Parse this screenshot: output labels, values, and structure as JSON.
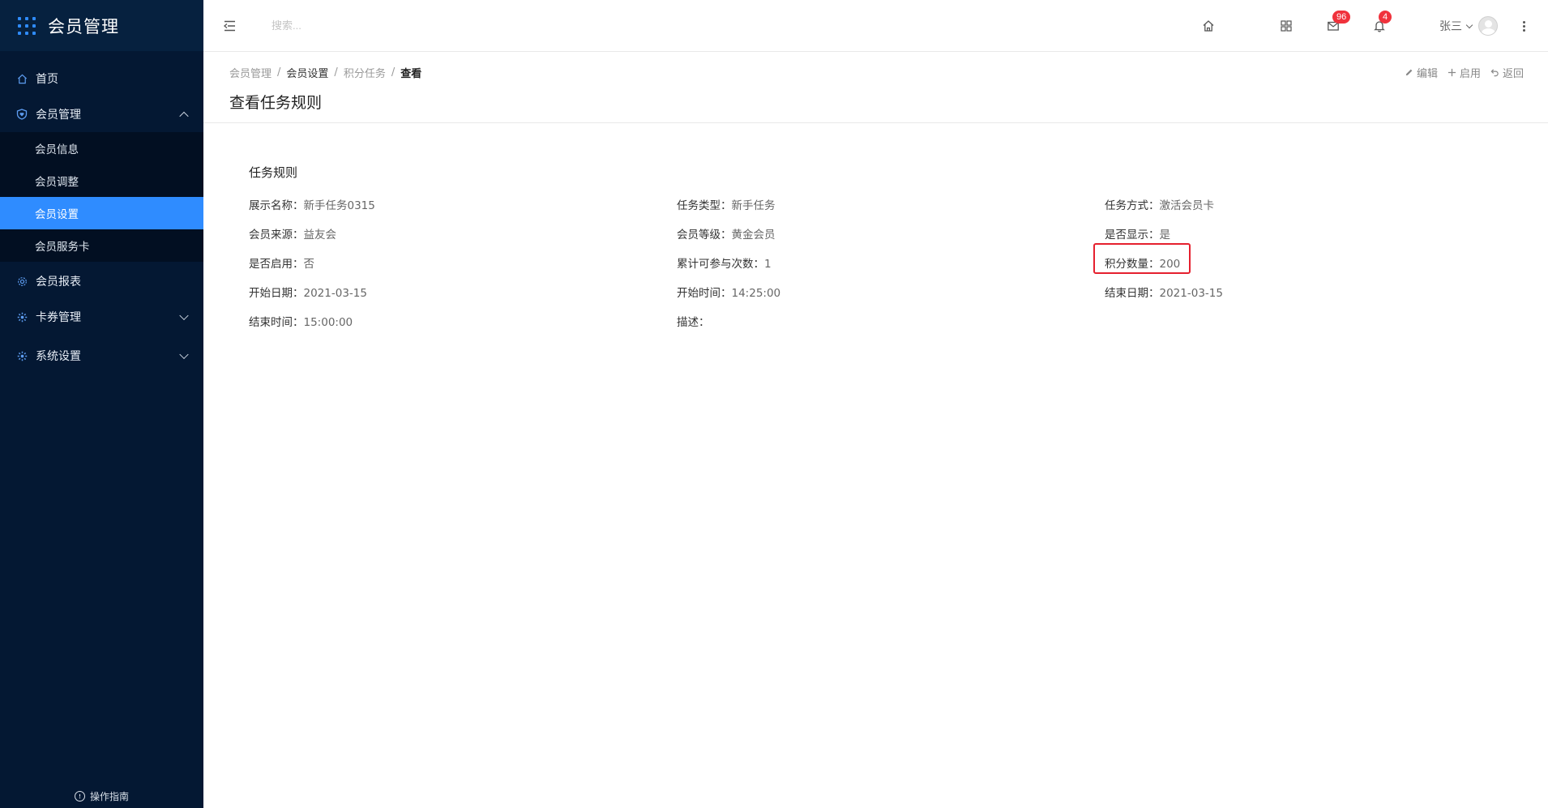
{
  "app": {
    "title": "会员管理"
  },
  "sidebar": {
    "menu": [
      {
        "label": "首页",
        "icon": "home-icon"
      },
      {
        "label": "会员管理",
        "icon": "shield-heart-icon",
        "expanded": true,
        "children": [
          {
            "label": "会员信息",
            "active": false
          },
          {
            "label": "会员调整",
            "active": false
          },
          {
            "label": "会员设置",
            "active": true
          },
          {
            "label": "会员服务卡",
            "active": false
          }
        ]
      },
      {
        "label": "会员报表",
        "icon": "gear-icon"
      },
      {
        "label": "卡券管理",
        "icon": "settings-icon"
      },
      {
        "label": "系统设置",
        "icon": "settings-icon"
      }
    ],
    "guide": "操作指南"
  },
  "header": {
    "search_placeholder": "搜索...",
    "mail_count": "96",
    "notify_count": "4",
    "user_name": "张三"
  },
  "breadcrumb": [
    "会员管理",
    "会员设置",
    "积分任务",
    "查看"
  ],
  "page": {
    "title": "查看任务规则"
  },
  "actions": {
    "edit": "编辑",
    "enable": "启用",
    "back": "返回"
  },
  "section": {
    "title": "任务规则"
  },
  "fields": [
    {
      "label": "展示名称：",
      "value": "新手任务0315"
    },
    {
      "label": "任务类型：",
      "value": "新手任务"
    },
    {
      "label": "任务方式：",
      "value": "激活会员卡"
    },
    {
      "label": "会员来源：",
      "value": "益友会"
    },
    {
      "label": "会员等级：",
      "value": "黄金会员"
    },
    {
      "label": "是否显示：",
      "value": "是"
    },
    {
      "label": "是否启用：",
      "value": "否"
    },
    {
      "label": "累计可参与次数：",
      "value": "1"
    },
    {
      "label": "积分数量：",
      "value": "200"
    },
    {
      "label": "开始日期：",
      "value": "2021-03-15"
    },
    {
      "label": "开始时间：",
      "value": "14:25:00"
    },
    {
      "label": "结束日期：",
      "value": "2021-03-15"
    },
    {
      "label": "结束时间：",
      "value": "15:00:00"
    },
    {
      "label": "描述：",
      "value": ""
    }
  ],
  "colors": {
    "sidebar_bg": "#041833",
    "accent": "#2f8cff",
    "badge": "#f0323c",
    "highlight": "#e5202e"
  }
}
